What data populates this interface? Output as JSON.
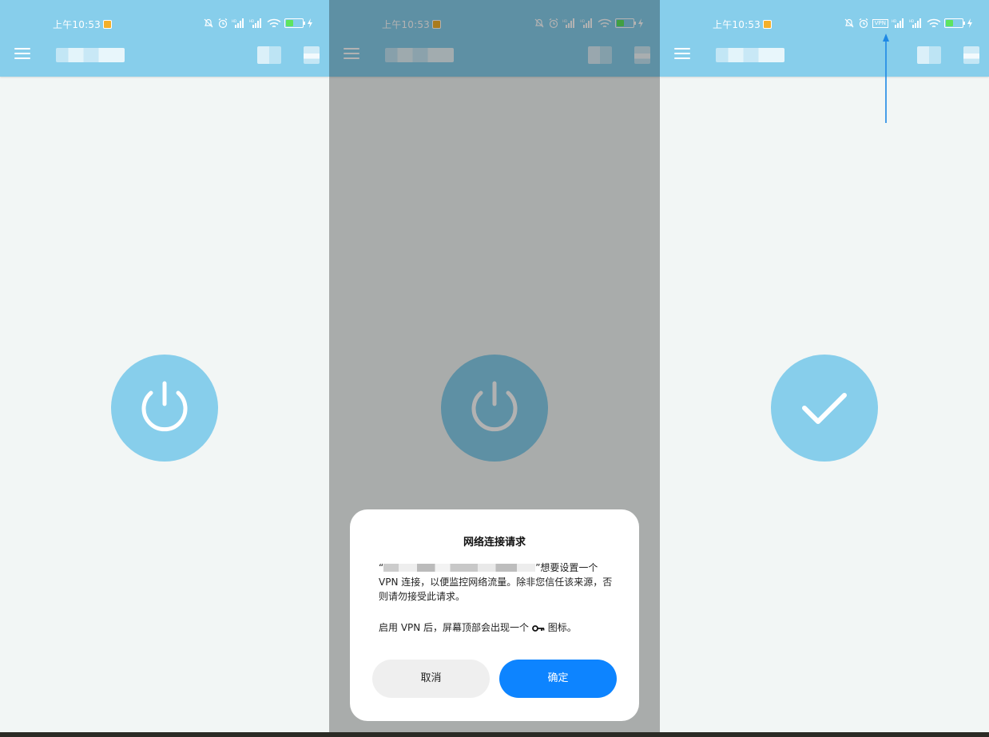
{
  "status_bar": {
    "time": "上午10:53",
    "battery_level": "18",
    "vpn_label": "VPN"
  },
  "colors": {
    "app_bar": "#87ceeb",
    "accent": "#0d84ff",
    "background": "#f2f6f5"
  },
  "panels": [
    {
      "state": "power-off",
      "icon": "power-icon"
    },
    {
      "state": "permission-dialog",
      "icon": "power-icon"
    },
    {
      "state": "connected",
      "icon": "check-icon"
    }
  ],
  "dialog": {
    "title": "网络连接请求",
    "body_open_quote": "“",
    "body_close_quote": "”想要设置一个 VPN 连接，以便监控网络流量。除非您信任该来源，否则请勿接受此请求。",
    "note_prefix": "启用 VPN 后，屏幕顶部会出现一个",
    "note_suffix": "图标。",
    "cancel_label": "取消",
    "ok_label": "确定"
  }
}
